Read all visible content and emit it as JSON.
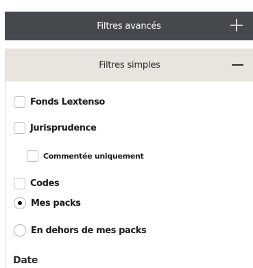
{
  "advanced_filters": {
    "label": "Filtres avancés",
    "icon": "plus-icon",
    "background": "#45494d"
  },
  "simple_filters": {
    "label": "Filtres simples",
    "icon": "minus-icon",
    "background": "#e8e5df",
    "options": [
      {
        "label": "Fonds Lextenso",
        "type": "checkbox",
        "checked": false
      },
      {
        "label": "Jurisprudence",
        "type": "checkbox",
        "checked": false
      },
      {
        "label": "Commentée uniquement",
        "type": "checkbox",
        "checked": false
      },
      {
        "label": "Codes",
        "type": "checkbox",
        "checked": false
      },
      {
        "label": "Mes packs",
        "type": "radio",
        "checked": true
      },
      {
        "label": "En dehors de mes packs",
        "type": "radio",
        "checked": false
      }
    ]
  },
  "date_section": {
    "label": "Date"
  }
}
